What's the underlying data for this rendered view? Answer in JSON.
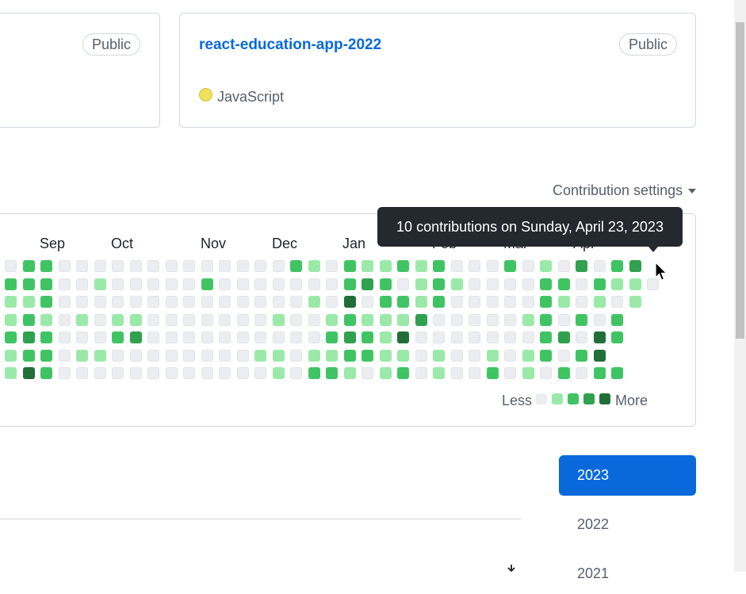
{
  "repos": [
    {
      "name": "",
      "visibility": "Public"
    },
    {
      "name": "react-education-app-2022",
      "visibility": "Public",
      "language": "JavaScript",
      "language_color": "#f1e05a"
    }
  ],
  "contributions": {
    "settings_label": "Contribution settings",
    "months": [
      "Sep",
      "Oct",
      "Nov",
      "Dec",
      "Jan",
      "Feb",
      "Mar",
      "Apr"
    ],
    "tooltip": "10 contributions on Sunday, April 23, 2023",
    "legend_less": "Less",
    "legend_more": "More",
    "level_colors": [
      "#ebedf0",
      "#9be9a8",
      "#40c463",
      "#30a14e",
      "#216e39"
    ],
    "grid": [
      [
        0,
        2,
        2,
        0,
        0,
        0,
        0,
        0,
        0,
        0,
        0,
        0,
        0,
        0,
        0,
        0,
        2,
        1,
        0,
        2,
        1,
        1,
        2,
        1,
        2,
        0,
        0,
        0,
        2,
        0,
        1,
        0,
        3,
        0,
        2,
        3
      ],
      [
        2,
        2,
        2,
        0,
        0,
        1,
        0,
        0,
        0,
        0,
        0,
        2,
        0,
        0,
        0,
        0,
        0,
        0,
        0,
        2,
        3,
        2,
        0,
        1,
        2,
        1,
        0,
        0,
        0,
        0,
        2,
        2,
        0,
        2,
        1,
        1,
        0
      ],
      [
        1,
        1,
        2,
        0,
        0,
        0,
        0,
        0,
        0,
        0,
        0,
        0,
        0,
        0,
        0,
        0,
        0,
        1,
        0,
        4,
        0,
        2,
        2,
        1,
        2,
        0,
        0,
        0,
        0,
        0,
        2,
        1,
        0,
        1,
        0,
        1
      ],
      [
        1,
        2,
        1,
        0,
        1,
        0,
        1,
        1,
        0,
        0,
        0,
        0,
        0,
        0,
        0,
        1,
        0,
        0,
        1,
        2,
        1,
        1,
        1,
        3,
        0,
        0,
        0,
        0,
        0,
        1,
        2,
        0,
        2,
        0,
        2
      ],
      [
        2,
        3,
        2,
        0,
        0,
        0,
        2,
        3,
        0,
        0,
        0,
        0,
        0,
        0,
        0,
        0,
        0,
        0,
        2,
        3,
        2,
        1,
        4,
        0,
        0,
        0,
        0,
        0,
        0,
        0,
        2,
        3,
        0,
        4,
        2
      ],
      [
        1,
        2,
        2,
        0,
        1,
        1,
        0,
        0,
        0,
        0,
        0,
        0,
        0,
        0,
        1,
        1,
        0,
        1,
        1,
        2,
        2,
        1,
        1,
        0,
        1,
        0,
        0,
        1,
        0,
        1,
        2,
        0,
        2,
        4
      ],
      [
        1,
        4,
        2,
        0,
        0,
        0,
        0,
        0,
        0,
        0,
        0,
        0,
        0,
        0,
        0,
        1,
        0,
        2,
        2,
        1,
        0,
        1,
        2,
        0,
        1,
        0,
        0,
        2,
        0,
        1,
        0,
        2,
        0,
        2,
        2
      ]
    ]
  },
  "years": [
    "2023",
    "2022",
    "2021"
  ]
}
